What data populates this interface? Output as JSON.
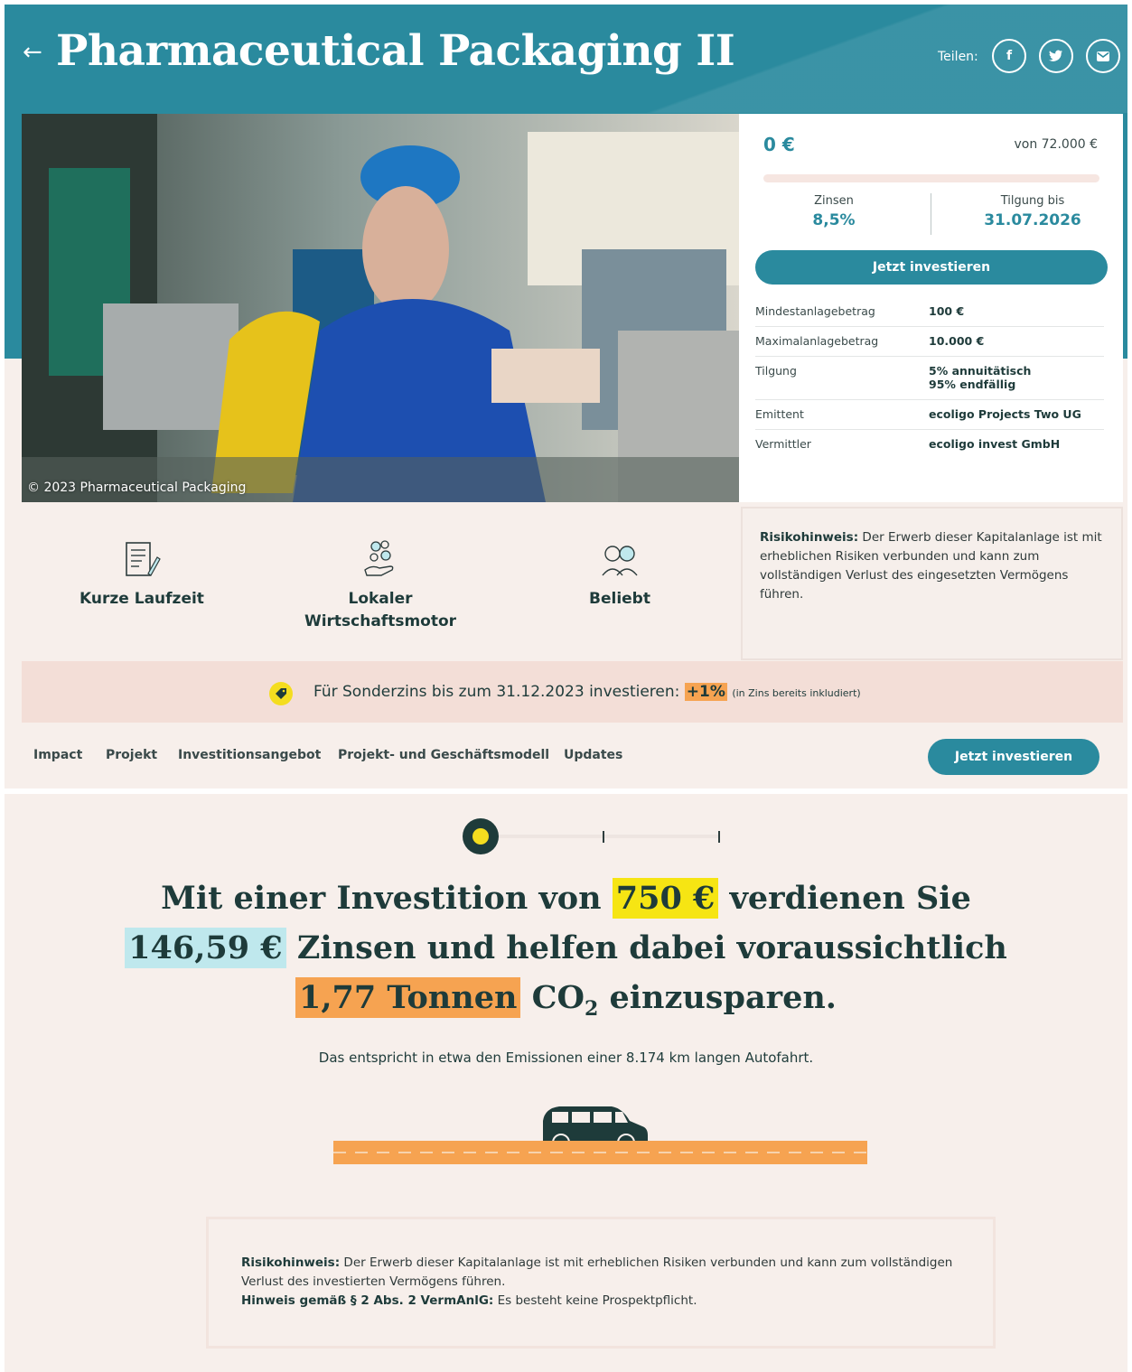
{
  "header": {
    "back_icon": "arrow-left-icon",
    "title": "Pharmaceutical Packaging II",
    "share_label": "Teilen:",
    "share_icons": [
      "facebook-icon",
      "twitter-icon",
      "mail-icon"
    ]
  },
  "photo": {
    "credit": "© 2023 Pharmaceutical Packaging"
  },
  "investment": {
    "amount": "0 €",
    "goal": "von 72.000 €",
    "progress": 0,
    "interest_label": "Zinsen",
    "interest_value": "8,5%",
    "repayment_label": "Tilgung bis",
    "repayment_value": "31.07.2026",
    "cta": "Jetzt investieren",
    "details": [
      {
        "key": "Mindestanlagebetrag",
        "value": "100 €"
      },
      {
        "key": "Maximalanlagebetrag",
        "value": "10.000 €"
      },
      {
        "key": "Tilgung",
        "value": "5% annuitätisch",
        "value2": "95% endfällig"
      },
      {
        "key": "Emittent",
        "value": "ecoligo Projects Two UG"
      },
      {
        "key": "Vermittler",
        "value": "ecoligo invest GmbH"
      }
    ]
  },
  "features": [
    {
      "label": "Kurze Laufzeit",
      "icon": "document-icon"
    },
    {
      "label": "Lokaler Wirtschaftsmotor",
      "icon": "coins-hand-icon"
    },
    {
      "label": "Beliebt",
      "icon": "people-icon"
    }
  ],
  "risk_card": {
    "title": "Risikohinweis:",
    "text": "Der Erwerb dieser Kapitalanlage ist mit erheblichen Risiken verbunden und kann zum vollständigen Verlust des eingesetzten Vermögens führen."
  },
  "promo": {
    "icon": "tag-icon",
    "text": "Für Sonderzins bis zum 31.12.2023 investieren:",
    "bonus": "+1%",
    "note": "(in Zins bereits inkludiert)"
  },
  "nav": {
    "items": [
      "Impact",
      "Projekt",
      "Investitionsangebot",
      "Projekt- und Geschäftsmodell",
      "Updates"
    ],
    "cta": "Jetzt investieren"
  },
  "calculator": {
    "slider_position": 0,
    "headline_1": "Mit einer Investition von",
    "amount": "750 €",
    "headline_2": "verdienen Sie",
    "interest": "146,59 €",
    "headline_3": "Zinsen und helfen dabei voraussichtlich",
    "co2": "1,77 Tonnen",
    "headline_4a": "CO",
    "headline_4sub": "2",
    "headline_4b": "einzusparen.",
    "subline": "Das entspricht in etwa den Emissionen einer 8.174 km langen Autofahrt.",
    "car_icon": "car-icon"
  },
  "risk_footer": {
    "title": "Risikohinweis:",
    "text": "Der Erwerb dieser Kapitalanlage ist mit erheblichen Risiken verbunden und kann zum vollständigen Verlust des investierten Vermögens führen.",
    "note_title": "Hinweis gemäß § 2 Abs. 2 VermAnlG:",
    "note_text": "Es besteht keine Prospektpflicht."
  }
}
